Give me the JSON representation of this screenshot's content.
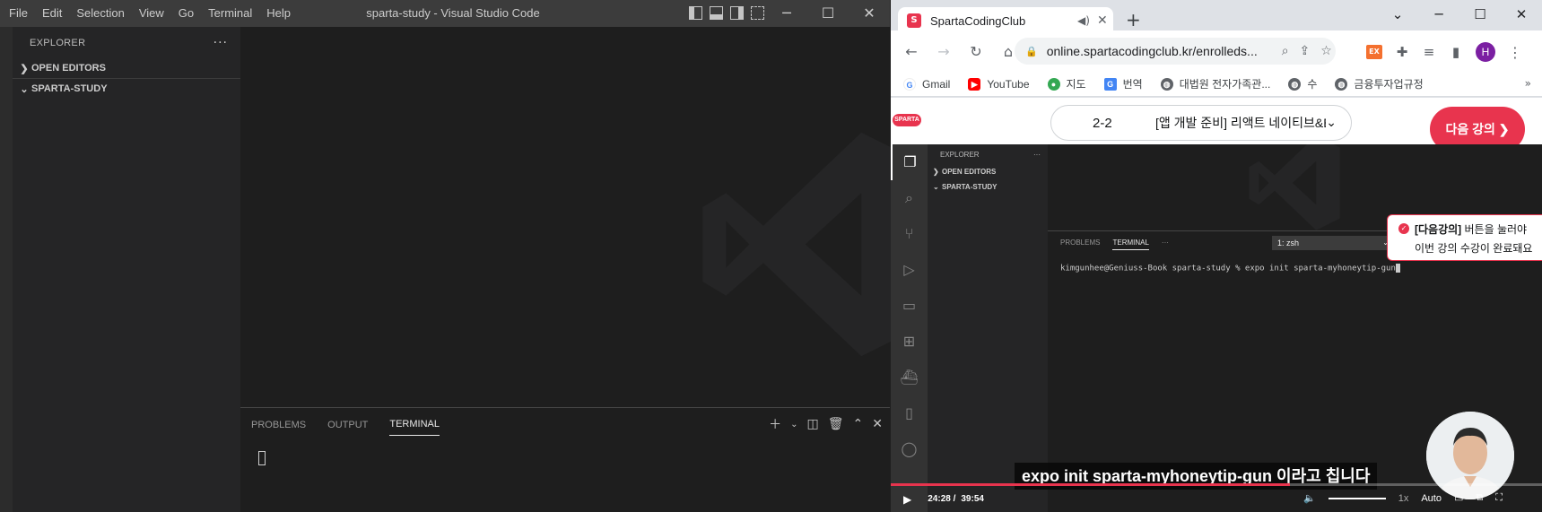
{
  "vscode": {
    "menu": [
      "File",
      "Edit",
      "Selection",
      "View",
      "Go",
      "Terminal",
      "Help"
    ],
    "title": "sparta-study - Visual Studio Code",
    "explorer_title": "EXPLORER",
    "sections": {
      "open_editors": "OPEN EDITORS",
      "workspace": "SPARTA-STUDY"
    },
    "panel_tabs": {
      "problems": "PROBLEMS",
      "output": "OUTPUT",
      "terminal": "TERMINAL"
    }
  },
  "chrome": {
    "tab_title": "SpartaCodingClub",
    "url": "online.spartacodingclub.kr/enrolleds...",
    "avatar_initial": "H",
    "bookmarks": [
      "Gmail",
      "YouTube",
      "지도",
      "번역",
      "대법원 전자가족관...",
      "수",
      "금융투자업규정"
    ]
  },
  "page": {
    "logo": "SPARTA",
    "lesson_number": "2-2",
    "lesson_title": "[앱 개발 준비] 리액트 네이티브&Ex",
    "next_button": "다음 강의",
    "tooltip": {
      "bold": "[다음강의]",
      "line1_rest": " 버튼을 눌러야",
      "line2": "이번 강의 수강이 완료돼요"
    }
  },
  "video": {
    "inner_explorer": "EXPLORER",
    "inner_open_editors": "OPEN EDITORS",
    "inner_workspace": "SPARTA-STUDY",
    "inner_tabs": {
      "problems": "PROBLEMS",
      "terminal": "TERMINAL"
    },
    "terminal_select": "1: zsh",
    "terminal_line": "kimgunhee@Geniuss-Book sparta-study % expo init sparta-myhoneytip-gun",
    "subtitle": "expo init sparta-myhoneytip-gun 이라고 칩니다",
    "current_time": "24:28 /",
    "duration": "39:54",
    "progress": 0.613,
    "speed": "1x",
    "quality": "Auto"
  }
}
